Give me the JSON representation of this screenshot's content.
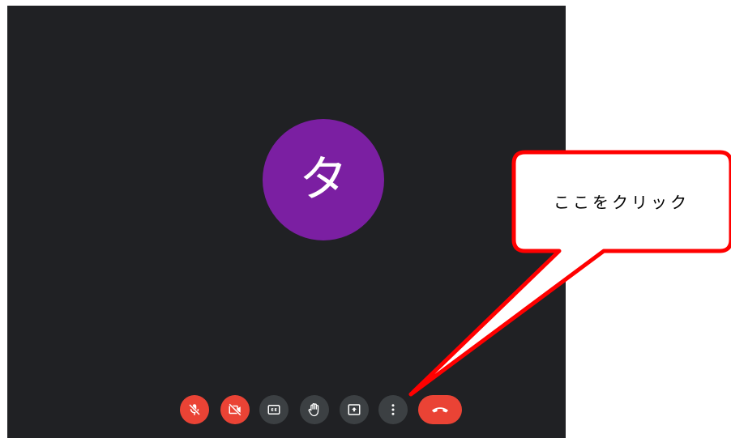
{
  "participant": {
    "initial": "タ",
    "avatar_color": "#7b1fa2"
  },
  "controls": [
    {
      "icon": "mic-off-icon",
      "state": "off",
      "color": "#ea4335"
    },
    {
      "icon": "camera-off-icon",
      "state": "off",
      "color": "#ea4335"
    },
    {
      "icon": "captions-icon",
      "color": "#3c4043"
    },
    {
      "icon": "raise-hand-icon",
      "color": "#3c4043"
    },
    {
      "icon": "present-screen-icon",
      "color": "#3c4043"
    },
    {
      "icon": "more-options-icon",
      "color": "#3c4043"
    },
    {
      "icon": "end-call-icon",
      "color": "#ea4335"
    }
  ],
  "annotation": {
    "text": "ここをクリック",
    "border_color": "#ff0000",
    "target": "more-options-button"
  },
  "theme": {
    "meeting_background": "#202124"
  }
}
